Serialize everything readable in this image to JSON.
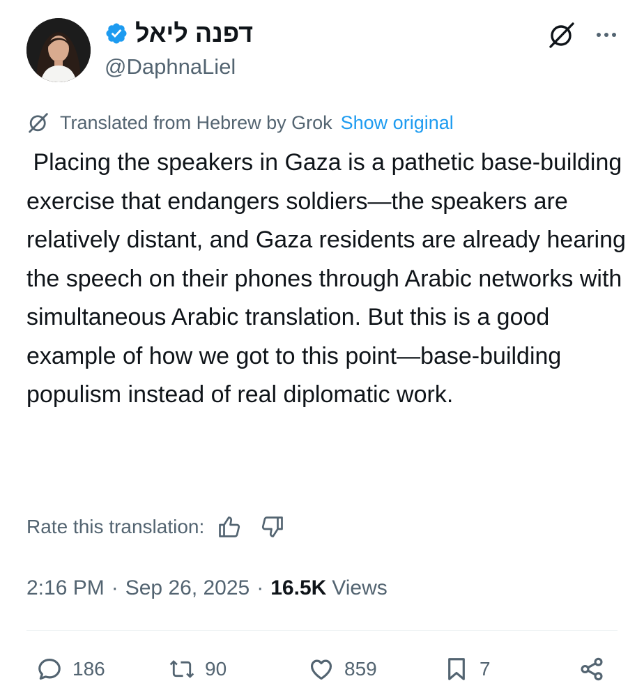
{
  "author": {
    "display_name": "דפנה ליאל",
    "handle": "@DaphnaLiel",
    "verified": true
  },
  "translation": {
    "label": "Translated from Hebrew by Grok",
    "show_original": "Show original"
  },
  "tweet": {
    "text": " Placing the speakers in Gaza is a pathetic base-building exercise that endangers soldiers—the speakers are relatively distant, and Gaza residents are already hearing the speech on their phones through Arabic networks with simultaneous Arabic translation. But this is a good example of how we got to this point—base-building populism instead of real diplomatic work."
  },
  "rate": {
    "label": "Rate this translation:"
  },
  "meta": {
    "time": "2:16 PM",
    "separator": "·",
    "date": "Sep 26, 2025",
    "views_count": "16.5K",
    "views_label": "Views"
  },
  "actions": {
    "replies": "186",
    "reposts": "90",
    "likes": "859",
    "bookmarks": "7"
  },
  "colors": {
    "accent": "#1d9bf0",
    "secondary_text": "#536471",
    "primary_text": "#0f1419"
  },
  "icons": [
    "verified-badge-icon",
    "grok-icon",
    "more-icon",
    "thumbs-up-icon",
    "thumbs-down-icon",
    "reply-icon",
    "repost-icon",
    "like-icon",
    "bookmark-icon",
    "share-icon"
  ]
}
